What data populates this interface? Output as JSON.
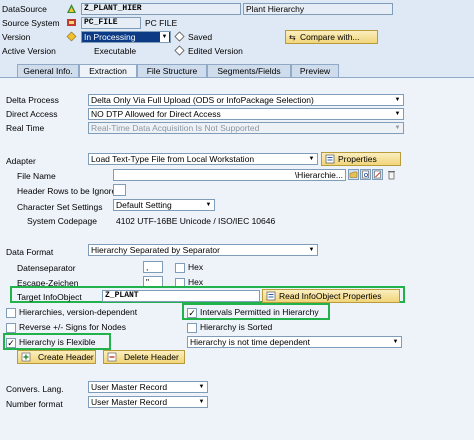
{
  "header": {
    "datasource_label": "DataSource",
    "datasource_value": "Z_PLANT_HIER",
    "datasource_desc": "Plant Hierarchy",
    "source_system_label": "Source System",
    "source_system_value": "PC_FILE",
    "source_system_desc": "PC FILE",
    "version_label": "Version",
    "version_value": "In Processing",
    "saved_label": "Saved",
    "compare_label": "Compare with...",
    "active_version_label": "Active Version",
    "active_version_value": "Executable",
    "edited_version_label": "Edited Version"
  },
  "tabs": [
    "General Info.",
    "Extraction",
    "File Structure",
    "Segments/Fields",
    "Preview"
  ],
  "extraction": {
    "delta_process_label": "Delta Process",
    "delta_process_value": "Delta Only Via Full Upload (ODS or InfoPackage Selection)",
    "direct_access_label": "Direct Access",
    "direct_access_value": "NO DTP Allowed for Direct Access",
    "real_time_label": "Real Time",
    "real_time_value": "Real-Time Data Acquisition Is Not Supported",
    "adapter_label": "Adapter",
    "adapter_value": "Load Text-Type File from Local Workstation",
    "properties_label": "Properties",
    "file_name_label": "File Name",
    "file_name_value": "\\Hierarchie...",
    "header_rows_label": "Header Rows to be Ignored",
    "header_rows_value": "",
    "charset_label": "Character Set Settings",
    "charset_value": "Default Setting",
    "codepage_label": "System Codepage",
    "codepage_value": "4102  UTF-16BE Unicode / ISO/IEC 10646",
    "data_format_label": "Data Format",
    "data_format_value": "Hierarchy Separated by Separator",
    "datenseparator_label": "Datenseparator",
    "datenseparator_value": ",",
    "hex_label": "Hex",
    "escape_label": "Escape-Zeichen",
    "escape_value": "\"",
    "hex2_label": "Hex",
    "target_io_label": "Target InfoObject",
    "target_io_value": "Z_PLANT",
    "read_io_label": "Read InfoObject Properties",
    "hier_version_label": "Hierarchies, version-dependent",
    "intervals_label": "Intervals Permitted in Hierarchy",
    "reverse_label": "Reverse +/- Signs for Nodes",
    "sorted_label": "Hierarchy is Sorted",
    "flexible_label": "Hierarchy is Flexible",
    "time_dep_value": "Hierarchy is not time dependent",
    "create_header_label": "Create Header",
    "delete_header_label": "Delete Header",
    "conv_lang_label": "Convers. Lang.",
    "conv_lang_value": "User Master Record",
    "number_format_label": "Number format",
    "number_format_value": "User Master Record"
  },
  "colors": {
    "highlight": "#22b24c",
    "panel": "#eef3fa",
    "button": "#f1d57a"
  }
}
